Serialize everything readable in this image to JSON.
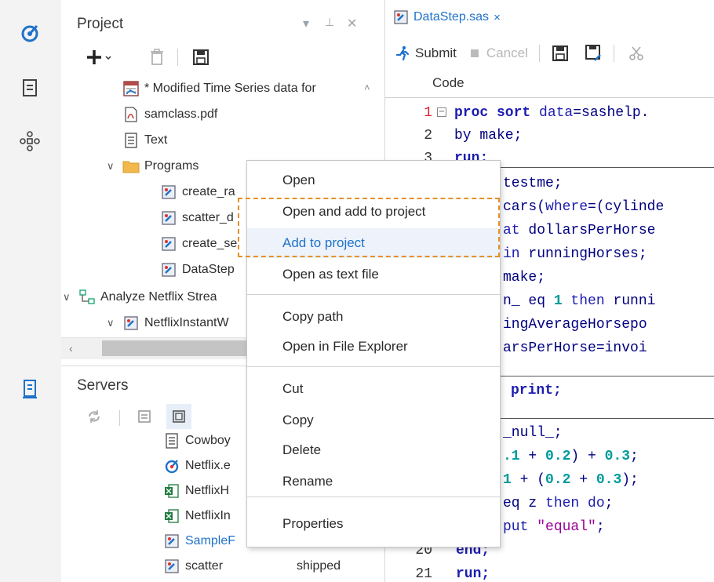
{
  "project": {
    "title": "Project",
    "tree": [
      {
        "label": "* Modified Time Series data for",
        "icon": "time-series-icon"
      },
      {
        "label": "samclass.pdf",
        "icon": "pdf-file-icon"
      },
      {
        "label": "Text",
        "icon": "text-file-icon"
      },
      {
        "label": "Programs",
        "icon": "folder-icon"
      },
      {
        "label": "create_ra",
        "icon": "sas-program-icon"
      },
      {
        "label": "scatter_d",
        "icon": "sas-program-icon"
      },
      {
        "label": "create_se",
        "icon": "sas-program-icon"
      },
      {
        "label": "DataStep",
        "icon": "sas-program-icon"
      },
      {
        "label": "Analyze Netflix Strea",
        "icon": "flow-icon"
      },
      {
        "label": "NetflixInstantW",
        "icon": "sas-program-icon"
      }
    ]
  },
  "servers": {
    "title": "Servers",
    "items": [
      {
        "label": "Cowboy",
        "icon": "text-file-icon"
      },
      {
        "label": "Netflix.e",
        "icon": "enterprise-guide-icon"
      },
      {
        "label": "NetflixH",
        "icon": "excel-file-icon"
      },
      {
        "label": "NetflixIn",
        "icon": "excel-file-icon"
      },
      {
        "label": "SampleF",
        "icon": "sas-program-icon"
      },
      {
        "label": "scatter",
        "icon": "sas-program-icon"
      },
      {
        "label": "shipped",
        "icon": ""
      }
    ]
  },
  "editor": {
    "tab_label": "DataStep.sas",
    "tab_close": "×",
    "submit_label": "Submit",
    "cancel_label": "Cancel",
    "code_label": "Code",
    "lines": [
      {
        "n": "1",
        "parts": [
          [
            "kw",
            "proc sort "
          ],
          [
            "fn",
            "data"
          ],
          [
            "plain",
            "=sashelp."
          ]
        ]
      },
      {
        "n": "2",
        "parts": [
          [
            "plain",
            "by make;"
          ]
        ]
      },
      {
        "n": "3",
        "parts": [
          [
            "kw",
            "run;"
          ]
        ]
      },
      {
        "n": "",
        "parts": [
          [
            "plain",
            "testme;"
          ]
        ]
      },
      {
        "n": "",
        "parts": [
          [
            "plain",
            "cars("
          ],
          [
            "fn",
            "where"
          ],
          [
            "plain",
            "=(cylinde"
          ]
        ]
      },
      {
        "n": "",
        "parts": [
          [
            "fn",
            "at"
          ],
          [
            "plain",
            " dollarsPerHorse"
          ]
        ]
      },
      {
        "n": "",
        "parts": [
          [
            "fn",
            "in"
          ],
          [
            "plain",
            " runningHorses;"
          ]
        ]
      },
      {
        "n": "",
        "parts": [
          [
            "plain",
            "make;"
          ]
        ]
      },
      {
        "n": "",
        "parts": [
          [
            "plain",
            "n_ eq "
          ],
          [
            "num",
            "1"
          ],
          [
            "fn",
            " then"
          ],
          [
            "plain",
            " runni"
          ]
        ]
      },
      {
        "n": "",
        "parts": [
          [
            "plain",
            "ingAverageHorsepo"
          ]
        ]
      },
      {
        "n": "",
        "parts": [
          [
            "plain",
            "arsPerHorse=invoi"
          ]
        ]
      },
      {
        "n": "",
        "parts": [
          [
            "kw",
            "print;"
          ]
        ]
      },
      {
        "n": "",
        "parts": [
          [
            "plain",
            "_null_;"
          ]
        ]
      },
      {
        "n": "",
        "parts": [
          [
            "num",
            ".1"
          ],
          [
            "plain",
            " + "
          ],
          [
            "num",
            "0.2"
          ],
          [
            "plain",
            ") + "
          ],
          [
            "num",
            "0.3"
          ],
          [
            "plain",
            ";"
          ]
        ]
      },
      {
        "n": "",
        "parts": [
          [
            "num",
            "1"
          ],
          [
            "plain",
            " + ("
          ],
          [
            "num",
            "0.2"
          ],
          [
            "plain",
            " + "
          ],
          [
            "num",
            "0.3"
          ],
          [
            "plain",
            ");"
          ]
        ]
      },
      {
        "n": "",
        "parts": [
          [
            "plain",
            "eq z "
          ],
          [
            "fn",
            "then"
          ],
          [
            "plain",
            " "
          ],
          [
            "fn",
            "do"
          ],
          [
            "plain",
            ";"
          ]
        ]
      },
      {
        "n": "",
        "parts": [
          [
            "fn",
            "put"
          ],
          [
            "plain",
            " "
          ],
          [
            "str",
            "\"equal\""
          ],
          [
            "plain",
            ";"
          ]
        ]
      },
      {
        "n": "20",
        "parts": [
          [
            "kw",
            "end;"
          ]
        ]
      },
      {
        "n": "21",
        "parts": [
          [
            "kw",
            "run;"
          ]
        ]
      }
    ]
  },
  "context_menu": {
    "items": [
      {
        "label": "Open"
      },
      {
        "label": "Open and add to project"
      },
      {
        "label": "Add to project"
      },
      {
        "label": "Open as text file"
      },
      {
        "label": "Copy path"
      },
      {
        "label": "Open in File Explorer"
      },
      {
        "label": "Cut"
      },
      {
        "label": "Copy"
      },
      {
        "label": "Delete"
      },
      {
        "label": "Rename"
      },
      {
        "label": "Properties"
      }
    ]
  },
  "colors": {
    "accent": "#1f72c9",
    "highlight_dash": "#e39128"
  }
}
